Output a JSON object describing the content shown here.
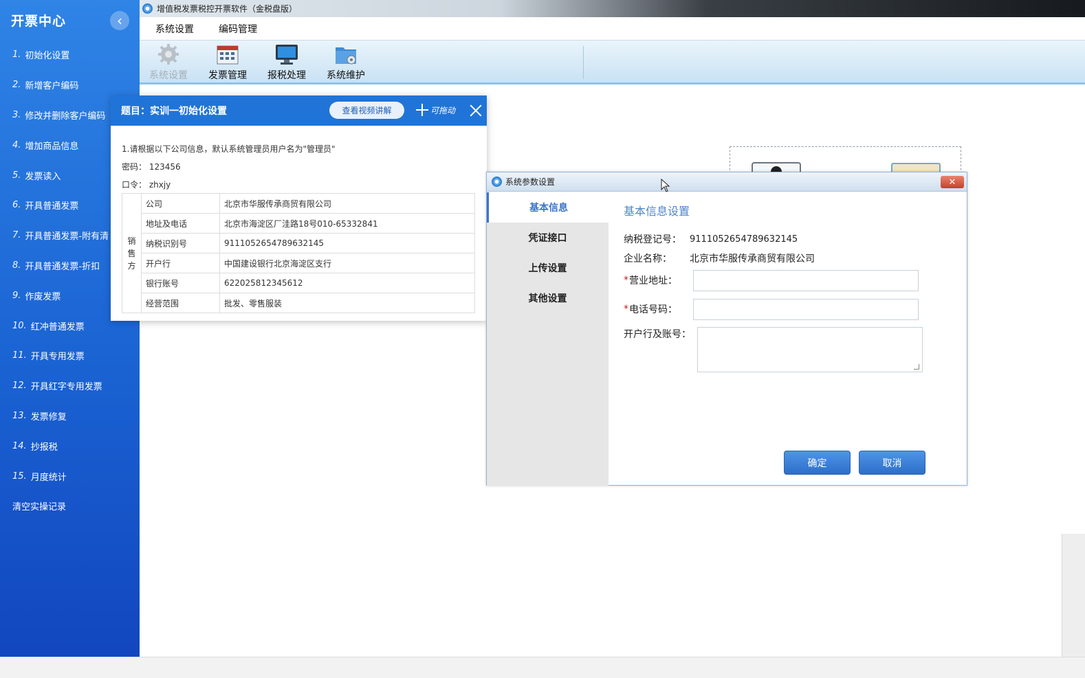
{
  "sidebar": {
    "title": "开票中心",
    "items": [
      {
        "num": "1.",
        "label": "初始化设置"
      },
      {
        "num": "2.",
        "label": "新增客户编码"
      },
      {
        "num": "3.",
        "label": "修改并删除客户编码"
      },
      {
        "num": "4.",
        "label": "增加商品信息"
      },
      {
        "num": "5.",
        "label": "发票读入"
      },
      {
        "num": "6.",
        "label": "开具普通发票"
      },
      {
        "num": "7.",
        "label": "开具普通发票-附有清"
      },
      {
        "num": "8.",
        "label": "开具普通发票-折扣"
      },
      {
        "num": "9.",
        "label": "作废发票"
      },
      {
        "num": "10.",
        "label": "红冲普通发票"
      },
      {
        "num": "11.",
        "label": "开具专用发票"
      },
      {
        "num": "12.",
        "label": "开具红字专用发票"
      },
      {
        "num": "13.",
        "label": "发票修复"
      },
      {
        "num": "14.",
        "label": "抄报税"
      },
      {
        "num": "15.",
        "label": "月度统计"
      }
    ],
    "clear_label": "清空实操记录"
  },
  "app": {
    "title": "增值税发票税控开票软件（金税盘版）",
    "menu": [
      "系统设置",
      "编码管理"
    ],
    "toolbar": [
      {
        "label": "系统设置",
        "icon": "gear-icon",
        "disabled": true
      },
      {
        "label": "发票管理",
        "icon": "invoice-grid-icon",
        "disabled": false
      },
      {
        "label": "报税处理",
        "icon": "monitor-icon",
        "disabled": false
      },
      {
        "label": "系统维护",
        "icon": "folder-gear-icon",
        "disabled": false
      }
    ]
  },
  "task": {
    "title": "题目：实训一初始化设置",
    "video_button": "查看视频讲解",
    "drag_label": "可拖动",
    "instruction": "1.请根据以下公司信息，默认系统管理员用户名为\"管理员\"",
    "password_line": "密码：  123456",
    "code_line": "口令：  zhxjy",
    "seller_label": "销售方",
    "rows": [
      {
        "key": "公司",
        "value": "北京市华服传承商贸有限公司"
      },
      {
        "key": "地址及电话",
        "value": "北京市海淀区厂洼路18号010-65332841"
      },
      {
        "key": "纳税识别号",
        "value": "9111052654789632145"
      },
      {
        "key": "开户行",
        "value": "中国建设银行北京海淀区支行"
      },
      {
        "key": "银行账号",
        "value": "622025812345612"
      },
      {
        "key": "经营范围",
        "value": "批发、零售服装"
      }
    ]
  },
  "dialog": {
    "title": "系统参数设置",
    "nav": [
      "基本信息",
      "凭证接口",
      "上传设置",
      "其他设置"
    ],
    "section_title": "基本信息设置",
    "tax_id_label": "纳税登记号：",
    "tax_id_value": "9111052654789632145",
    "company_label": "企业名称：",
    "company_value": "北京市华服传承商贸有限公司",
    "address_label": "营业地址：",
    "address_value": "",
    "phone_label": "电话号码：",
    "phone_value": "",
    "bank_label": "开户行及账号：",
    "bank_value": "",
    "ok_label": "确定",
    "cancel_label": "取消"
  },
  "colors": {
    "sidebar_blue": "#1a63d3",
    "header_blue": "#2074d8",
    "accent_blue": "#3a74c9",
    "required_red": "#d01818"
  }
}
